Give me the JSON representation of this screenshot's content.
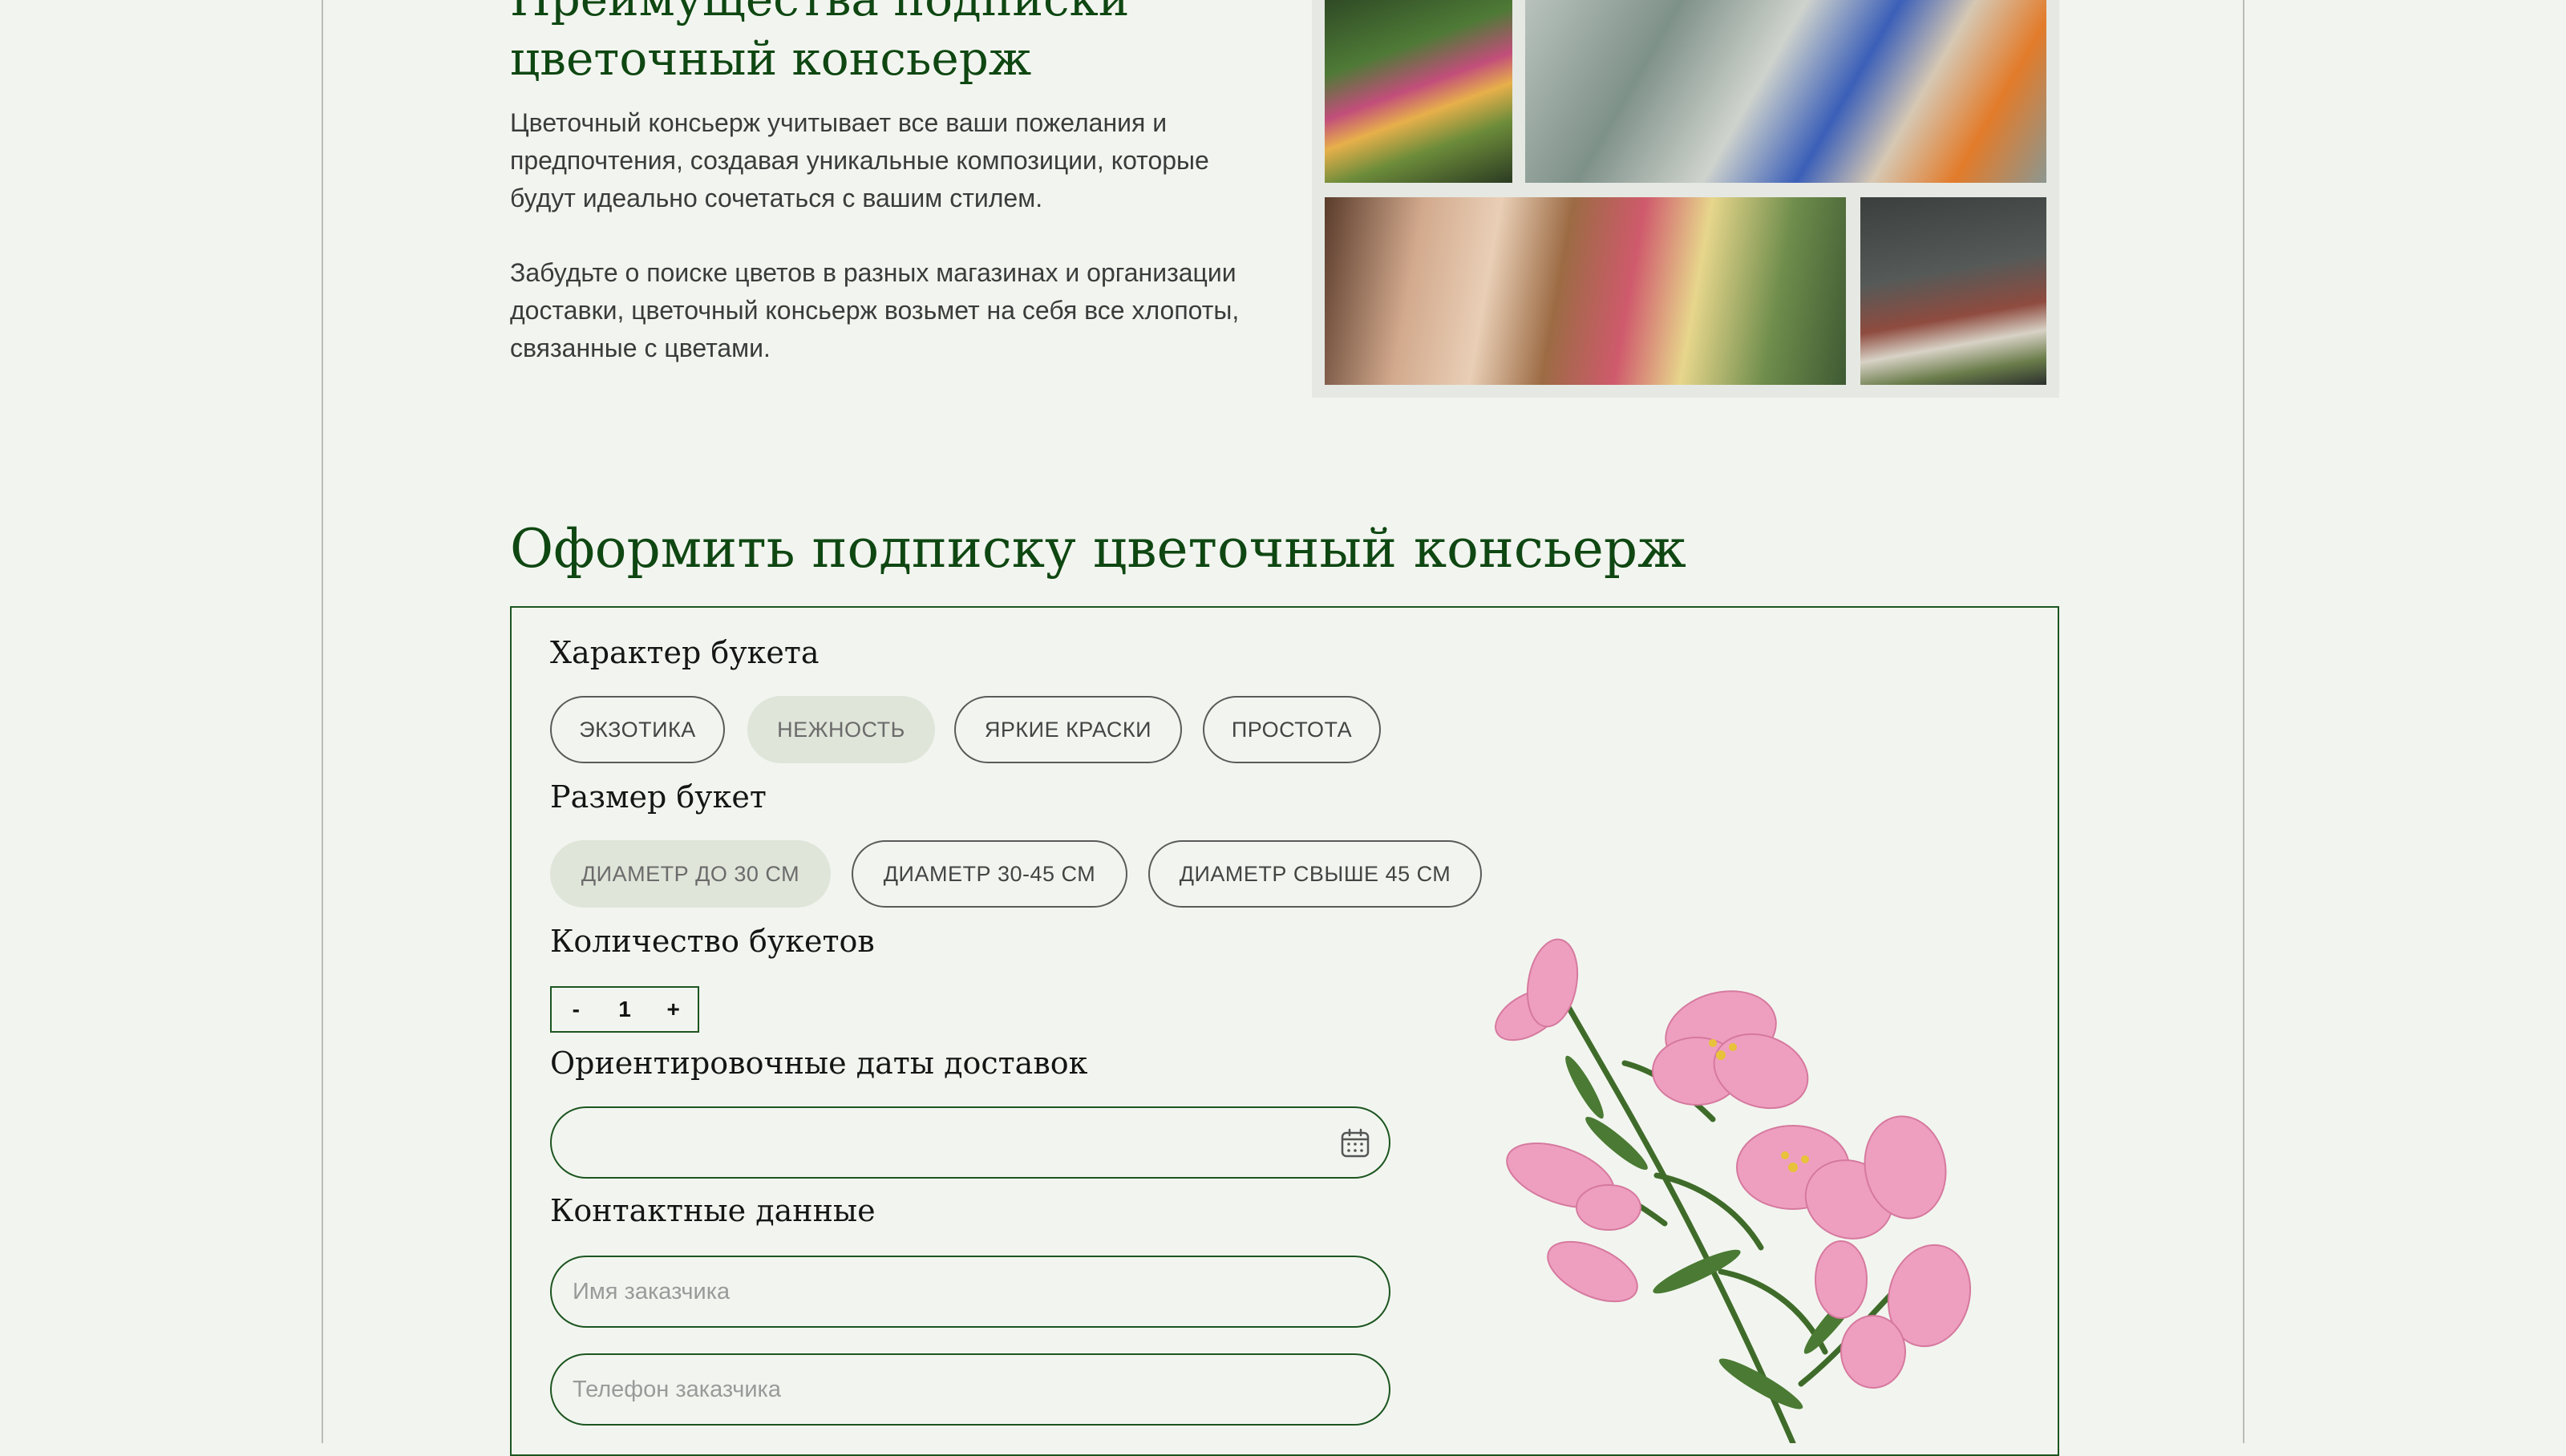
{
  "advantages": {
    "title_line1": "Преимущества подписки",
    "title_line2": "цветочный консьерж",
    "paragraph1": "Цветочный консьерж учитывает все ваши пожелания и предпочтения, создавая уникальные композиции, которые будут идеально сочетаться с вашим стилем.",
    "paragraph2": "Забудьте о поиске цветов в разных магазинах и организации доставки, цветочный консьерж возьмет на себя все хлопоты, связанные с цветами."
  },
  "subscription": {
    "title": "Оформить подписку цветочный консьерж",
    "character": {
      "label": "Характер букета",
      "options": [
        "ЭКЗОТИКА",
        "НЕЖНОСТЬ",
        "ЯРКИЕ КРАСКИ",
        "ПРОСТОТА"
      ],
      "selected": "НЕЖНОСТЬ"
    },
    "size": {
      "label": "Размер букет",
      "options": [
        "ДИАМЕТР ДО 30 СМ",
        "ДИАМЕТР 30-45 СМ",
        "ДИАМЕТР СВЫШЕ 45 СМ"
      ],
      "selected": "ДИАМЕТР ДО 30 СМ"
    },
    "quantity": {
      "label": "Количество букетов",
      "minus": "-",
      "value": "1",
      "plus": "+"
    },
    "dates": {
      "label": "Ориентировочные даты доставок",
      "value": "",
      "icon": "calendar-icon"
    },
    "contacts": {
      "label": "Контактные данные",
      "name_placeholder": "Имя заказчика",
      "phone_placeholder": "Телефон заказчика"
    }
  },
  "colors": {
    "accent_green": "#0f4712",
    "border_green": "#1c5520",
    "background": "#f2f5ef",
    "chip_selected": "#dfe5d9"
  }
}
